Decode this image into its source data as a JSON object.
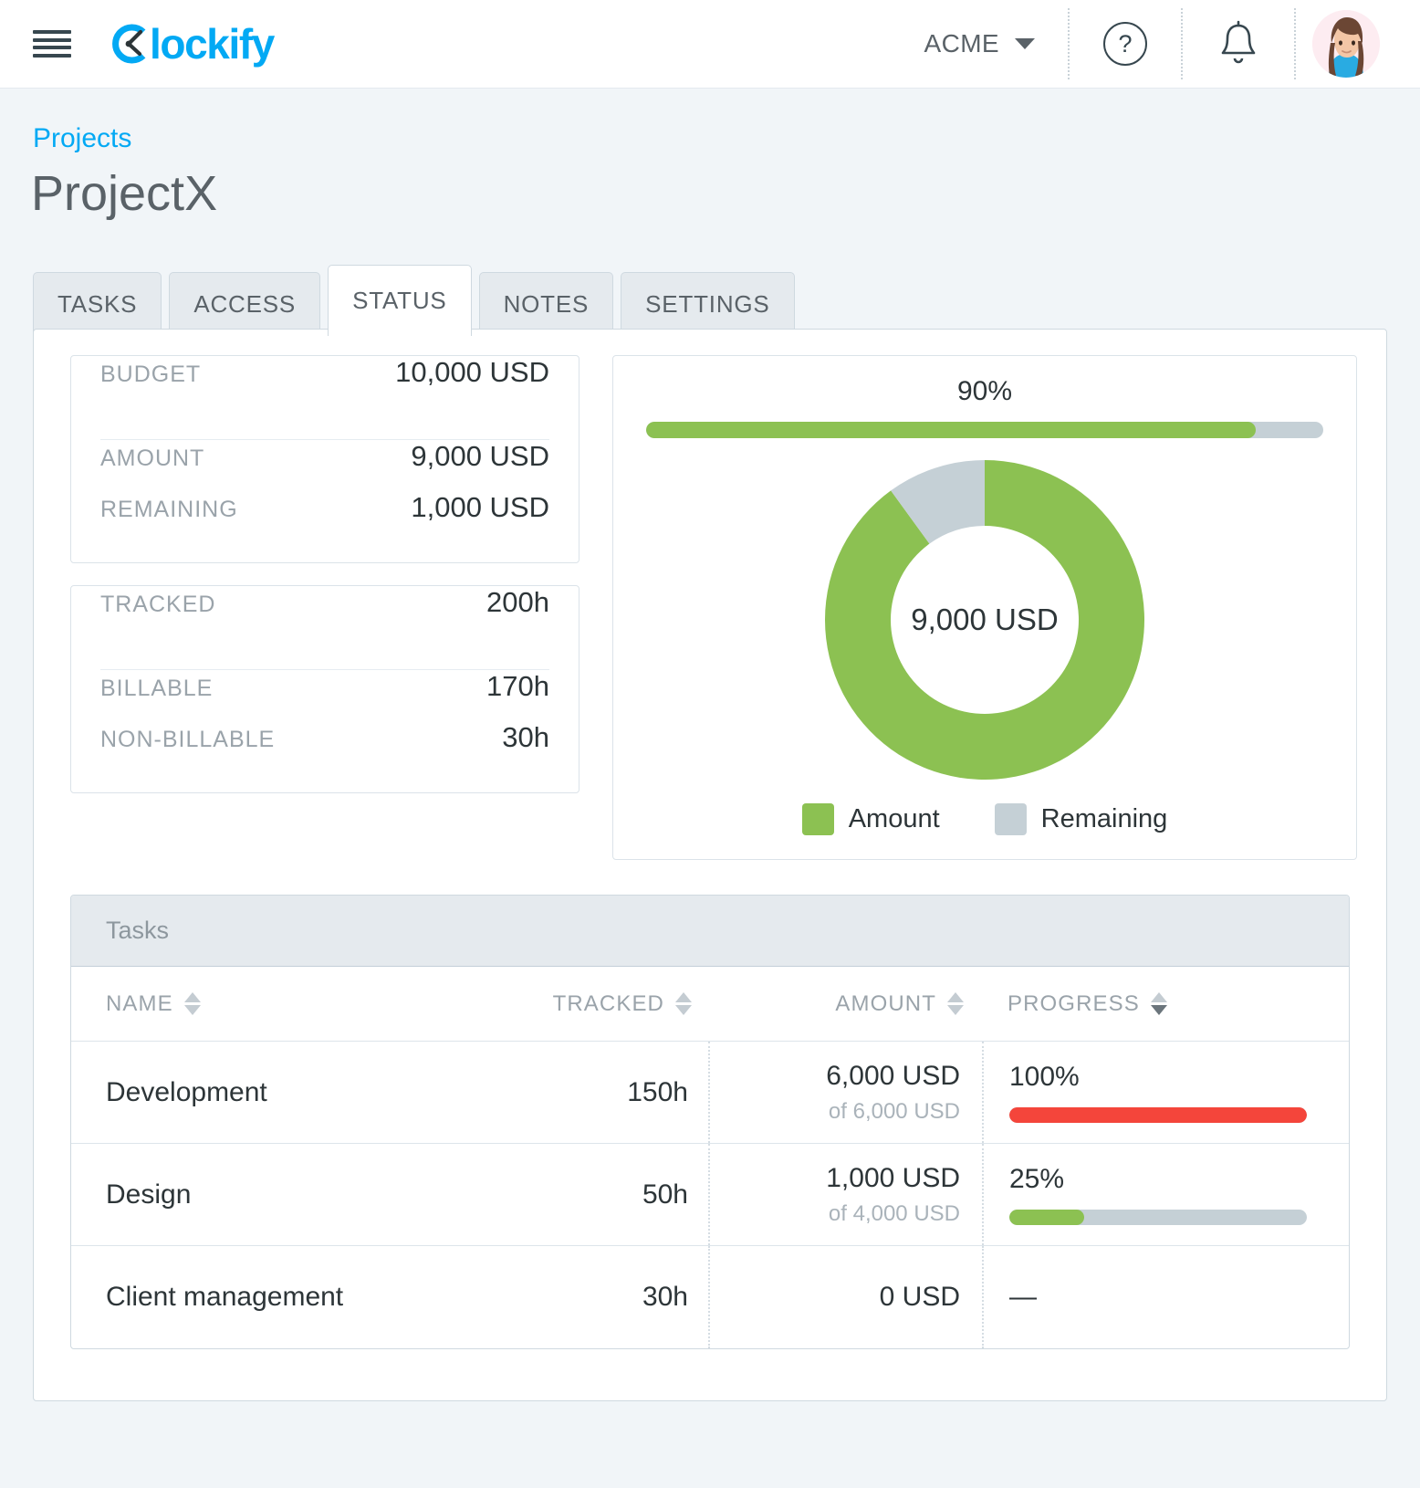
{
  "topbar": {
    "menu_icon": "hamburger-icon",
    "logo_text": "lockify",
    "org_name": "ACME",
    "help_icon": "?",
    "bell_icon": "bell-icon",
    "avatar_icon": "user-avatar"
  },
  "breadcrumb": {
    "parent": "Projects"
  },
  "page_title": "ProjectX",
  "tabs": [
    {
      "label": "TASKS",
      "active": false
    },
    {
      "label": "ACCESS",
      "active": false
    },
    {
      "label": "STATUS",
      "active": true
    },
    {
      "label": "NOTES",
      "active": false
    },
    {
      "label": "SETTINGS",
      "active": false
    }
  ],
  "budget_box": {
    "primary_label": "BUDGET",
    "primary_value": "10,000 USD",
    "amount_label": "AMOUNT",
    "amount_value": "9,000 USD",
    "remaining_label": "REMAINING",
    "remaining_value": "1,000 USD"
  },
  "time_box": {
    "primary_label": "TRACKED",
    "primary_value": "200h",
    "billable_label": "BILLABLE",
    "billable_value": "170h",
    "nonbillable_label": "NON-BILLABLE",
    "nonbillable_value": "30h"
  },
  "chart_data": {
    "type": "pie",
    "title": "",
    "center_label": "9,000 USD",
    "progress_percent_label": "90%",
    "progress_percent": 90,
    "labels": [
      "Amount",
      "Remaining"
    ],
    "values": [
      9000,
      1000
    ],
    "percentages": [
      90,
      10
    ],
    "colors": [
      "#8cc152",
      "#c5d0d6"
    ],
    "legend_position": "bottom",
    "unit": "USD"
  },
  "tasks_table": {
    "section_title": "Tasks",
    "columns": [
      {
        "label": "NAME",
        "sort": "none"
      },
      {
        "label": "TRACKED",
        "sort": "none"
      },
      {
        "label": "AMOUNT",
        "sort": "none"
      },
      {
        "label": "PROGRESS",
        "sort": "desc"
      }
    ],
    "rows": [
      {
        "name": "Development",
        "tracked": "150h",
        "amount": "6,000 USD",
        "amount_of": "of 6,000 USD",
        "progress_label": "100%",
        "progress_value": 100,
        "progress_color": "#f4453b",
        "has_bar": true
      },
      {
        "name": "Design",
        "tracked": "50h",
        "amount": "1,000 USD",
        "amount_of": "of 4,000 USD",
        "progress_label": "25%",
        "progress_value": 25,
        "progress_color": "#8cc152",
        "has_bar": true
      },
      {
        "name": "Client management",
        "tracked": "30h",
        "amount": "0 USD",
        "amount_of": "",
        "progress_label": "—",
        "progress_value": 0,
        "progress_color": "",
        "has_bar": false
      }
    ]
  },
  "colors": {
    "brand": "#03a9f4",
    "green": "#8cc152",
    "gray_track": "#c5d0d6",
    "red": "#f4453b",
    "page_bg": "#f1f5f8"
  }
}
